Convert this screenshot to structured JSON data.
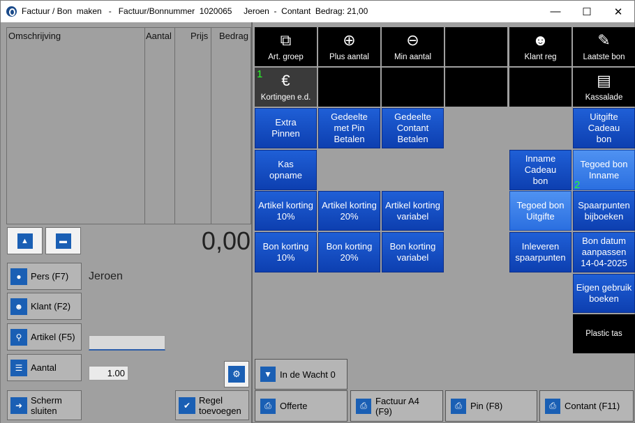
{
  "window": {
    "title": "Factuur / Bon  maken   -   Factuur/Bonnummer  1020065     Jeroen  -  Contant  Bedrag: 21,00",
    "minimize": "—",
    "maximize": "☐",
    "close": "✕"
  },
  "grid": {
    "columns": [
      "Omschrijving",
      "Aantal",
      "Prijs",
      "Bedrag"
    ]
  },
  "total": "0,00",
  "left_buttons": {
    "pers": "Pers (F7)",
    "klant": "Klant (F2)",
    "artikel": "Artikel (F5)",
    "aantal": "Aantal",
    "scherm_sluiten_1": "Scherm",
    "scherm_sluiten_2": "sluiten",
    "regel_1": "Regel",
    "regel_2": "toevoegen"
  },
  "seller_name": "Jeroen",
  "quantity_value": "1.00",
  "tiles": {
    "art_groep": "Art. groep",
    "plus_aantal": "Plus aantal",
    "min_aantal": "Min aantal",
    "klant_reg": "Klant reg",
    "laatste_bon": "Laatste bon",
    "kortingen": "Kortingen e.d.",
    "kassalade": "Kassalade",
    "extra_pinnen_1": "Extra",
    "extra_pinnen_2": "Pinnen",
    "ged_pin_1": "Gedeelte",
    "ged_pin_2": "met Pin",
    "ged_pin_3": "Betalen",
    "ged_contant_1": "Gedeelte",
    "ged_contant_2": "Contant",
    "ged_contant_3": "Betalen",
    "uitgifte_cadeau_1": "Uitgifte",
    "uitgifte_cadeau_2": "Cadeau",
    "uitgifte_cadeau_3": "bon",
    "kas_opname_1": "Kas",
    "kas_opname_2": "opname",
    "inname_cadeau_1": "Inname",
    "inname_cadeau_2": "Cadeau",
    "inname_cadeau_3": "bon",
    "tegoed_inname_1": "Tegoed bon",
    "tegoed_inname_2": "Inname",
    "art_korting_10_1": "Artikel korting",
    "art_korting_10_2": "10%",
    "art_korting_20_1": "Artikel korting",
    "art_korting_20_2": "20%",
    "art_korting_var_1": "Artikel korting",
    "art_korting_var_2": "variabel",
    "tegoed_uitgifte_1": "Tegoed bon",
    "tegoed_uitgifte_2": "Uitgifte",
    "spaarpunten_bij_1": "Spaarpunten",
    "spaarpunten_bij_2": "bijboeken",
    "bon_korting_10_1": "Bon korting",
    "bon_korting_10_2": "10%",
    "bon_korting_20_1": "Bon korting",
    "bon_korting_20_2": "20%",
    "bon_korting_var_1": "Bon korting",
    "bon_korting_var_2": "variabel",
    "inleveren_1": "Inleveren",
    "inleveren_2": "spaarpunten",
    "bon_datum_1": "Bon datum",
    "bon_datum_2": "aanpassen",
    "bon_datum_3": "14-04-2025",
    "eigen_gebruik_1": "Eigen gebruik",
    "eigen_gebruik_2": "boeken",
    "plastic_tas": "Plastic tas"
  },
  "tags": {
    "one": "1",
    "two": "2"
  },
  "bottom_buttons": {
    "wacht": "In de Wacht 0",
    "offerte": "Offerte",
    "factuur_1": "Factuur A4",
    "factuur_2": "(F9)",
    "pin": "Pin (F8)",
    "contant": "Contant (F11)"
  }
}
